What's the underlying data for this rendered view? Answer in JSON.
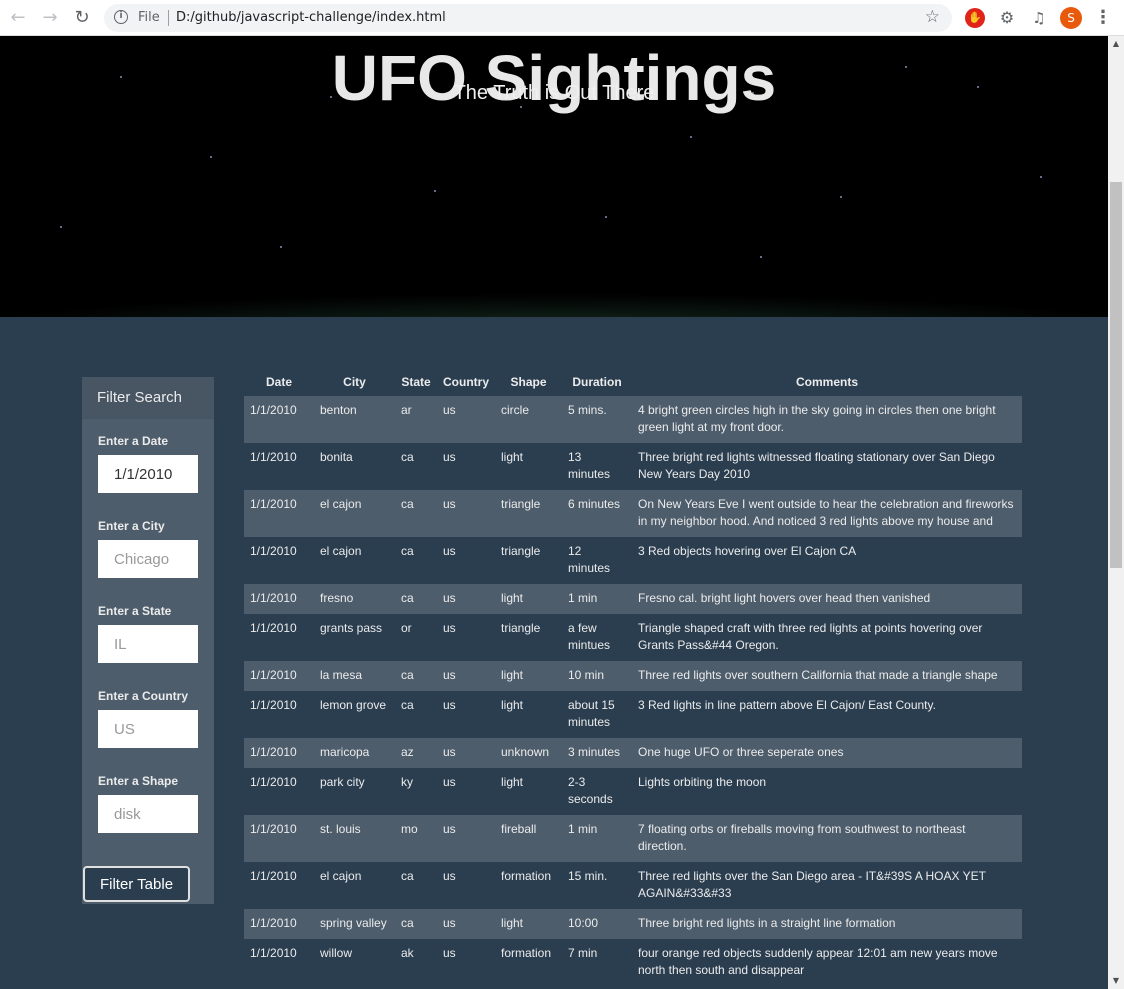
{
  "browser": {
    "scheme": "File",
    "url": "D:/github/javascript-challenge/index.html",
    "profile_initial": "S",
    "icons": [
      "back-icon",
      "forward-icon",
      "reload-icon",
      "info-icon",
      "star-icon",
      "ublock-icon",
      "puzzle-icon",
      "media-icon",
      "more-icon"
    ]
  },
  "hero": {
    "title": "UFO Sightings",
    "subtitle": "The Truth is Out There"
  },
  "filter": {
    "heading": "Filter Search",
    "fields": [
      {
        "label": "Enter a Date",
        "value": "1/1/2010",
        "placeholder": "1/1/2010"
      },
      {
        "label": "Enter a City",
        "value": "",
        "placeholder": "Chicago"
      },
      {
        "label": "Enter a State",
        "value": "",
        "placeholder": "IL"
      },
      {
        "label": "Enter a Country",
        "value": "",
        "placeholder": "US"
      },
      {
        "label": "Enter a Shape",
        "value": "",
        "placeholder": "disk"
      }
    ],
    "button_label": "Filter Table"
  },
  "table": {
    "headers": [
      "Date",
      "City",
      "State",
      "Country",
      "Shape",
      "Duration",
      "Comments"
    ],
    "rows": [
      [
        "1/1/2010",
        "benton",
        "ar",
        "us",
        "circle",
        "5 mins.",
        "4 bright green circles high in the sky going in circles then one bright green light at my front door."
      ],
      [
        "1/1/2010",
        "bonita",
        "ca",
        "us",
        "light",
        "13 minutes",
        "Three bright red lights witnessed floating stationary over San Diego New Years Day 2010"
      ],
      [
        "1/1/2010",
        "el cajon",
        "ca",
        "us",
        "triangle",
        "6 minutes",
        "On New Years Eve I went outside to hear the celebration and fireworks in my neighbor hood. And noticed 3 red lights above my house and"
      ],
      [
        "1/1/2010",
        "el cajon",
        "ca",
        "us",
        "triangle",
        "12 minutes",
        "3 Red objects hovering over El Cajon CA"
      ],
      [
        "1/1/2010",
        "fresno",
        "ca",
        "us",
        "light",
        "1 min",
        "Fresno cal. bright light hovers over head then vanished"
      ],
      [
        "1/1/2010",
        "grants pass",
        "or",
        "us",
        "triangle",
        "a few mintues",
        "Triangle shaped craft with three red lights at points hovering over Grants Pass&#44 Oregon."
      ],
      [
        "1/1/2010",
        "la mesa",
        "ca",
        "us",
        "light",
        "10 min",
        "Three red lights over southern California that made a triangle shape"
      ],
      [
        "1/1/2010",
        "lemon grove",
        "ca",
        "us",
        "light",
        "about 15 minutes",
        "3 Red lights in line pattern above El Cajon/ East County."
      ],
      [
        "1/1/2010",
        "maricopa",
        "az",
        "us",
        "unknown",
        "3 minutes",
        "One huge UFO or three seperate ones"
      ],
      [
        "1/1/2010",
        "park city",
        "ky",
        "us",
        "light",
        "2-3 seconds",
        "Lights orbiting the moon"
      ],
      [
        "1/1/2010",
        "st. louis",
        "mo",
        "us",
        "fireball",
        "1 min",
        "7 floating orbs or fireballs moving from southwest to northeast direction."
      ],
      [
        "1/1/2010",
        "el cajon",
        "ca",
        "us",
        "formation",
        "15 min.",
        "Three red lights over the San Diego area - IT&#39S A HOAX YET AGAIN&#33&#33"
      ],
      [
        "1/1/2010",
        "spring valley",
        "ca",
        "us",
        "light",
        "10:00",
        "Three bright red lights in a straight line formation"
      ],
      [
        "1/1/2010",
        "willow",
        "ak",
        "us",
        "formation",
        "7 min",
        "four orange red objects suddenly appear 12:01 am new years move north then south and disappear"
      ]
    ]
  }
}
